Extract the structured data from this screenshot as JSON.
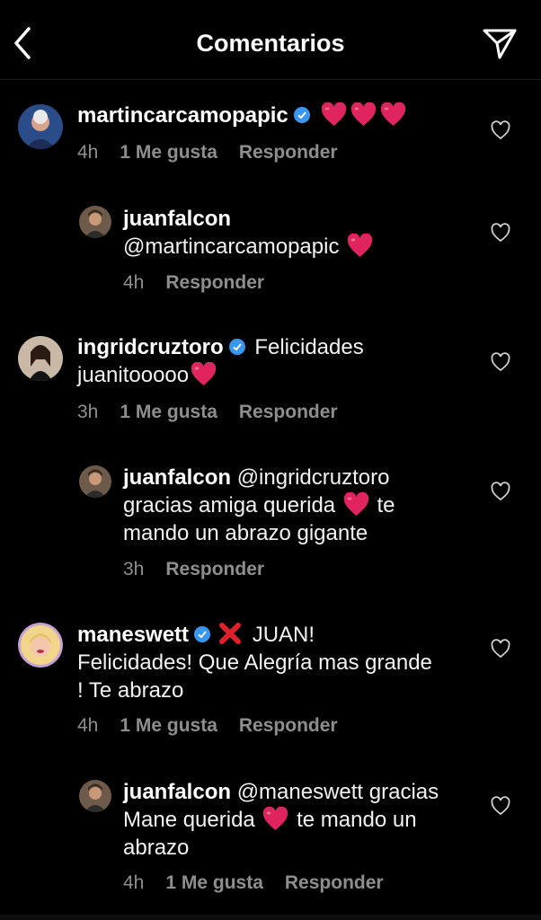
{
  "header": {
    "title": "Comentarios"
  },
  "comments": [
    {
      "user": "martincarcamopapic",
      "text": "",
      "hearts": 3,
      "time": "4h",
      "likes": "1 Me gusta",
      "reply": "Responder"
    },
    {
      "user": "juanfalcon",
      "mention": "@martincarcamopapic",
      "time": "4h",
      "reply": "Responder"
    },
    {
      "user": "ingridcruztoro",
      "text1": "Felicidades",
      "text2": "juanitooooo",
      "time": "3h",
      "likes": "1 Me gusta",
      "reply": "Responder"
    },
    {
      "user": "juanfalcon",
      "line1": "@ingridcruztoro",
      "line2a": "gracias amiga querida",
      "line2b": "te",
      "line3": "mando un abrazo gigante",
      "time": "3h",
      "reply": "Responder"
    },
    {
      "user": "maneswett",
      "line1": "JUAN!",
      "line2": "Felicidades! Que Alegría mas grande",
      "line3": "! Te abrazo",
      "time": "4h",
      "likes": "1 Me gusta",
      "reply": "Responder"
    },
    {
      "user": "juanfalcon",
      "line1": "@maneswett gracias",
      "line2a": "Mane querida",
      "line2b": "te mando un",
      "line3": "abrazo",
      "time": "4h",
      "likes": "1 Me gusta",
      "reply": "Responder"
    }
  ],
  "colors": {
    "background": "#000000",
    "meta": "#8e8e8e",
    "verified": "#3897f0",
    "heart": "#e0245e"
  },
  "icons": [
    "back-chevron-icon",
    "send-icon",
    "verified-icon",
    "heart-emoji",
    "like-heart-outline-icon",
    "cross-mark-emoji"
  ]
}
